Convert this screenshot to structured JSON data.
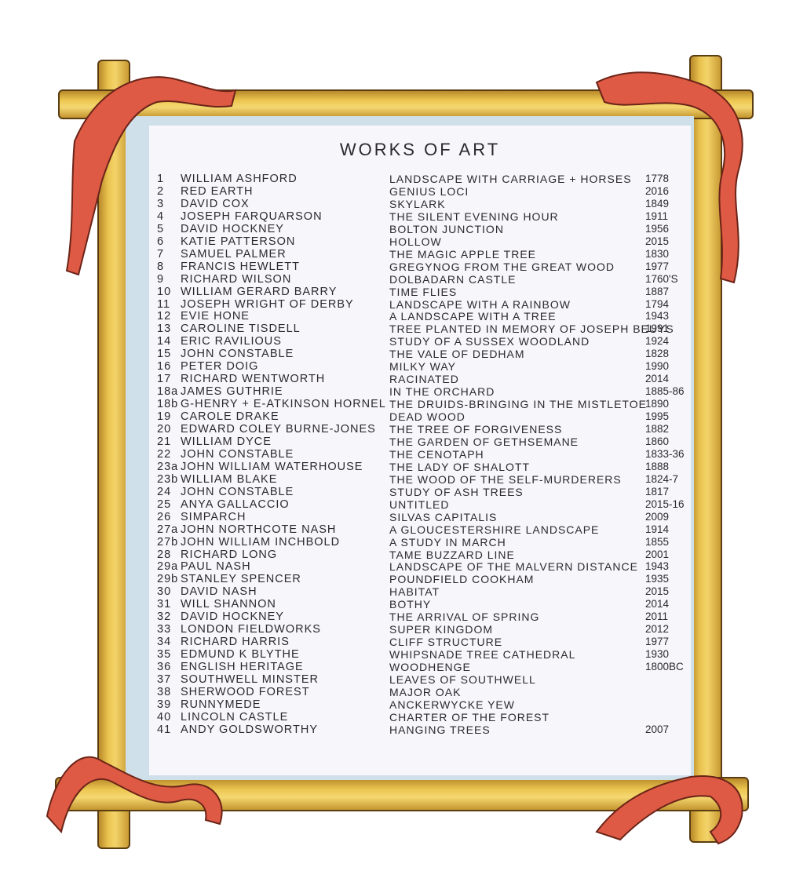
{
  "title": "WORKS OF ART",
  "colors": {
    "frame": "#e9c24e",
    "ribbon": "#d9533f",
    "paper": "#f7f6fa",
    "mat": "#cfe0ea",
    "ink": "#2c2a2e"
  },
  "works": [
    {
      "num": "1",
      "artist": "WILLIAM ASHFORD",
      "work": "LANDSCAPE WITH CARRIAGE + HORSES",
      "year": "1778"
    },
    {
      "num": "2",
      "artist": "RED EARTH",
      "work": "GENIUS LOCI",
      "year": "2016"
    },
    {
      "num": "3",
      "artist": "DAVID COX",
      "work": "SKYLARK",
      "year": "1849"
    },
    {
      "num": "4",
      "artist": "JOSEPH FARQUARSON",
      "work": "THE SILENT EVENING HOUR",
      "year": "1911"
    },
    {
      "num": "5",
      "artist": "DAVID HOCKNEY",
      "work": "BOLTON JUNCTION",
      "year": "1956"
    },
    {
      "num": "6",
      "artist": "KATIE PATTERSON",
      "work": "HOLLOW",
      "year": "2015"
    },
    {
      "num": "7",
      "artist": "SAMUEL PALMER",
      "work": "THE MAGIC APPLE TREE",
      "year": "1830"
    },
    {
      "num": "8",
      "artist": "FRANCIS HEWLETT",
      "work": "GREGYNOG FROM THE GREAT WOOD",
      "year": "1977"
    },
    {
      "num": "9",
      "artist": "RICHARD WILSON",
      "work": "DOLBADARN CASTLE",
      "year": "1760'S"
    },
    {
      "num": "10",
      "artist": "WILLIAM GERARD BARRY",
      "work": "TIME FLIES",
      "year": "1887"
    },
    {
      "num": "11",
      "artist": "JOSEPH WRIGHT OF DERBY",
      "work": "LANDSCAPE WITH A RAINBOW",
      "year": "1794"
    },
    {
      "num": "12",
      "artist": "EVIE HONE",
      "work": "A LANDSCAPE WITH A TREE",
      "year": "1943"
    },
    {
      "num": "13",
      "artist": "CAROLINE TISDELL",
      "work": "TREE PLANTED IN MEMORY OF JOSEPH BEUYS",
      "year": "1991"
    },
    {
      "num": "14",
      "artist": "ERIC RAVILIOUS",
      "work": "STUDY OF A SUSSEX WOODLAND",
      "year": "1924"
    },
    {
      "num": "15",
      "artist": "JOHN CONSTABLE",
      "work": "THE VALE OF DEDHAM",
      "year": "1828"
    },
    {
      "num": "16",
      "artist": "PETER DOIG",
      "work": "MILKY WAY",
      "year": "1990"
    },
    {
      "num": "17",
      "artist": "RICHARD WENTWORTH",
      "work": "RACINATED",
      "year": "2014"
    },
    {
      "num": "18a",
      "artist": "JAMES GUTHRIE",
      "work": "IN THE ORCHARD",
      "year": "1885-86"
    },
    {
      "num": "18b",
      "artist": "G-HENRY + E-ATKINSON HORNEL",
      "work": "THE DRUIDS-BRINGING IN THE MISTLETOE",
      "year": "1890"
    },
    {
      "num": "19",
      "artist": "CAROLE DRAKE",
      "work": "DEAD WOOD",
      "year": "1995"
    },
    {
      "num": "20",
      "artist": "EDWARD COLEY BURNE-JONES",
      "work": "THE TREE OF FORGIVENESS",
      "year": "1882"
    },
    {
      "num": "21",
      "artist": "WILLIAM DYCE",
      "work": "THE GARDEN OF GETHSEMANE",
      "year": "1860"
    },
    {
      "num": "22",
      "artist": "JOHN CONSTABLE",
      "work": "THE CENOTAPH",
      "year": "1833-36"
    },
    {
      "num": "23a",
      "artist": "JOHN WILLIAM WATERHOUSE",
      "work": "THE LADY OF SHALOTT",
      "year": "1888"
    },
    {
      "num": "23b",
      "artist": "WILLIAM BLAKE",
      "work": "THE WOOD OF THE SELF-MURDERERS",
      "year": "1824-7"
    },
    {
      "num": "24",
      "artist": "JOHN CONSTABLE",
      "work": "STUDY OF ASH TREES",
      "year": "1817"
    },
    {
      "num": "25",
      "artist": "ANYA GALLACCIO",
      "work": "UNTITLED",
      "year": "2015-16"
    },
    {
      "num": "26",
      "artist": "SIMPARCH",
      "work": "SILVAS CAPITALIS",
      "year": "2009"
    },
    {
      "num": "27a",
      "artist": "JOHN NORTHCOTE NASH",
      "work": "A GLOUCESTERSHIRE LANDSCAPE",
      "year": "1914"
    },
    {
      "num": "27b",
      "artist": "JOHN WILLIAM INCHBOLD",
      "work": "A STUDY IN MARCH",
      "year": "1855"
    },
    {
      "num": "28",
      "artist": "RICHARD LONG",
      "work": "TAME BUZZARD LINE",
      "year": "2001"
    },
    {
      "num": "29a",
      "artist": "PAUL NASH",
      "work": "LANDSCAPE OF THE MALVERN DISTANCE",
      "year": "1943"
    },
    {
      "num": "29b",
      "artist": "STANLEY SPENCER",
      "work": "POUNDFIELD COOKHAM",
      "year": "1935"
    },
    {
      "num": "30",
      "artist": "DAVID NASH",
      "work": "HABITAT",
      "year": "2015"
    },
    {
      "num": "31",
      "artist": "WILL SHANNON",
      "work": "BOTHY",
      "year": "2014"
    },
    {
      "num": "32",
      "artist": "DAVID HOCKNEY",
      "work": "THE ARRIVAL OF SPRING",
      "year": "2011"
    },
    {
      "num": "33",
      "artist": "LONDON FIELDWORKS",
      "work": "SUPER KINGDOM",
      "year": "2012"
    },
    {
      "num": "34",
      "artist": "RICHARD HARRIS",
      "work": "CLIFF STRUCTURE",
      "year": "1977"
    },
    {
      "num": "35",
      "artist": "EDMUND K BLYTHE",
      "work": "WHIPSNADE TREE CATHEDRAL",
      "year": "1930"
    },
    {
      "num": "36",
      "artist": "ENGLISH HERITAGE",
      "work": "WOODHENGE",
      "year": "1800BC"
    },
    {
      "num": "37",
      "artist": "SOUTHWELL MINSTER",
      "work": "LEAVES OF SOUTHWELL",
      "year": ""
    },
    {
      "num": "38",
      "artist": "SHERWOOD FOREST",
      "work": "MAJOR OAK",
      "year": ""
    },
    {
      "num": "39",
      "artist": "RUNNYMEDE",
      "work": "ANCKERWYCKE YEW",
      "year": ""
    },
    {
      "num": "40",
      "artist": "LINCOLN CASTLE",
      "work": "CHARTER OF THE FOREST",
      "year": ""
    },
    {
      "num": "41",
      "artist": "ANDY GOLDSWORTHY",
      "work": "HANGING TREES",
      "year": "2007"
    }
  ]
}
